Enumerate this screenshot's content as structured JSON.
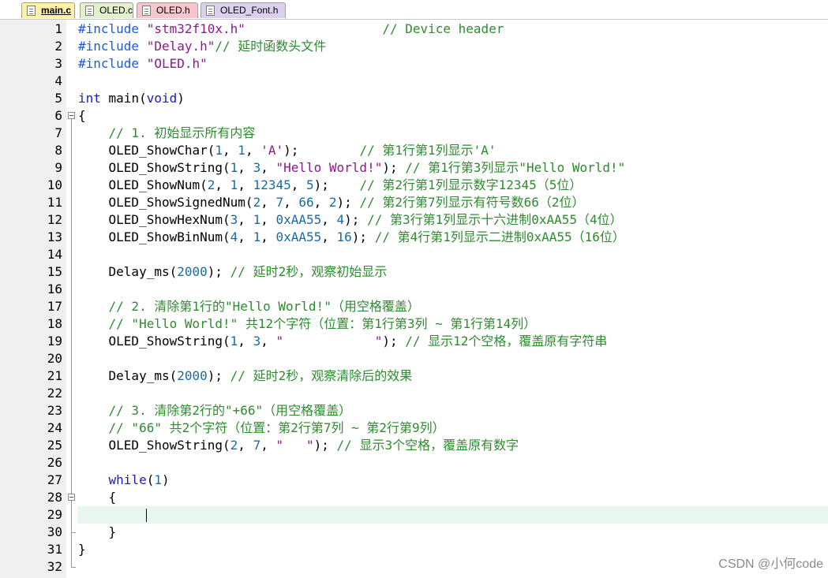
{
  "tabs": [
    {
      "label": "main.c",
      "active": true,
      "color": "#fff2a8"
    },
    {
      "label": "OLED.c",
      "active": false,
      "color": "#e2f0cc"
    },
    {
      "label": "OLED.h",
      "active": false,
      "color": "#f7c5cc"
    },
    {
      "label": "OLED_Font.h",
      "active": false,
      "color": "#dcd0ef"
    }
  ],
  "editor": {
    "current_line": 29,
    "lines": [
      [
        [
          "pp",
          "#include "
        ],
        [
          "str",
          "\"stm32f10x.h\""
        ],
        [
          "txt",
          "                  "
        ],
        [
          "cmt",
          "// Device header"
        ]
      ],
      [
        [
          "pp",
          "#include "
        ],
        [
          "str",
          "\"Delay.h\""
        ],
        [
          "cmt",
          "// 延时函数头文件"
        ]
      ],
      [
        [
          "pp",
          "#include "
        ],
        [
          "str",
          "\"OLED.h\""
        ]
      ],
      [],
      [
        [
          "kw",
          "int"
        ],
        [
          "txt",
          " main("
        ],
        [
          "kw",
          "void"
        ],
        [
          "txt",
          ")"
        ]
      ],
      [
        [
          "txt",
          "{"
        ]
      ],
      [
        [
          "txt",
          "    "
        ],
        [
          "cmt",
          "// 1. 初始显示所有内容"
        ]
      ],
      [
        [
          "txt",
          "    OLED_ShowChar("
        ],
        [
          "num",
          "1"
        ],
        [
          "txt",
          ", "
        ],
        [
          "num",
          "1"
        ],
        [
          "txt",
          ", "
        ],
        [
          "str",
          "'A'"
        ],
        [
          "txt",
          ");        "
        ],
        [
          "cmt",
          "// 第1行第1列显示'A'"
        ]
      ],
      [
        [
          "txt",
          "    OLED_ShowString("
        ],
        [
          "num",
          "1"
        ],
        [
          "txt",
          ", "
        ],
        [
          "num",
          "3"
        ],
        [
          "txt",
          ", "
        ],
        [
          "str",
          "\"Hello World!\""
        ],
        [
          "txt",
          "); "
        ],
        [
          "cmt",
          "// 第1行第3列显示\"Hello World!\""
        ]
      ],
      [
        [
          "txt",
          "    OLED_ShowNum("
        ],
        [
          "num",
          "2"
        ],
        [
          "txt",
          ", "
        ],
        [
          "num",
          "1"
        ],
        [
          "txt",
          ", "
        ],
        [
          "num",
          "12345"
        ],
        [
          "txt",
          ", "
        ],
        [
          "num",
          "5"
        ],
        [
          "txt",
          ");    "
        ],
        [
          "cmt",
          "// 第2行第1列显示数字12345（5位）"
        ]
      ],
      [
        [
          "txt",
          "    OLED_ShowSignedNum("
        ],
        [
          "num",
          "2"
        ],
        [
          "txt",
          ", "
        ],
        [
          "num",
          "7"
        ],
        [
          "txt",
          ", "
        ],
        [
          "num",
          "66"
        ],
        [
          "txt",
          ", "
        ],
        [
          "num",
          "2"
        ],
        [
          "txt",
          "); "
        ],
        [
          "cmt",
          "// 第2行第7列显示有符号数66（2位）"
        ]
      ],
      [
        [
          "txt",
          "    OLED_ShowHexNum("
        ],
        [
          "num",
          "3"
        ],
        [
          "txt",
          ", "
        ],
        [
          "num",
          "1"
        ],
        [
          "txt",
          ", "
        ],
        [
          "num",
          "0xAA55"
        ],
        [
          "txt",
          ", "
        ],
        [
          "num",
          "4"
        ],
        [
          "txt",
          "); "
        ],
        [
          "cmt",
          "// 第3行第1列显示十六进制0xAA55（4位）"
        ]
      ],
      [
        [
          "txt",
          "    OLED_ShowBinNum("
        ],
        [
          "num",
          "4"
        ],
        [
          "txt",
          ", "
        ],
        [
          "num",
          "1"
        ],
        [
          "txt",
          ", "
        ],
        [
          "num",
          "0xAA55"
        ],
        [
          "txt",
          ", "
        ],
        [
          "num",
          "16"
        ],
        [
          "txt",
          "); "
        ],
        [
          "cmt",
          "// 第4行第1列显示二进制0xAA55（16位）"
        ]
      ],
      [],
      [
        [
          "txt",
          "    Delay_ms("
        ],
        [
          "num",
          "2000"
        ],
        [
          "txt",
          "); "
        ],
        [
          "cmt",
          "// 延时2秒，观察初始显示"
        ]
      ],
      [],
      [
        [
          "txt",
          "    "
        ],
        [
          "cmt",
          "// 2. 清除第1行的\"Hello World!\"（用空格覆盖）"
        ]
      ],
      [
        [
          "txt",
          "    "
        ],
        [
          "cmt",
          "// \"Hello World!\" 共12个字符（位置：第1行第3列 ~ 第1行第14列）"
        ]
      ],
      [
        [
          "txt",
          "    OLED_ShowString("
        ],
        [
          "num",
          "1"
        ],
        [
          "txt",
          ", "
        ],
        [
          "num",
          "3"
        ],
        [
          "txt",
          ", "
        ],
        [
          "str",
          "\"            \""
        ],
        [
          "txt",
          "); "
        ],
        [
          "cmt",
          "// 显示12个空格，覆盖原有字符串"
        ]
      ],
      [],
      [
        [
          "txt",
          "    Delay_ms("
        ],
        [
          "num",
          "2000"
        ],
        [
          "txt",
          "); "
        ],
        [
          "cmt",
          "// 延时2秒，观察清除后的效果"
        ]
      ],
      [],
      [
        [
          "txt",
          "    "
        ],
        [
          "cmt",
          "// 3. 清除第2行的\"+66\"（用空格覆盖）"
        ]
      ],
      [
        [
          "txt",
          "    "
        ],
        [
          "cmt",
          "// \"66\" 共2个字符（位置：第2行第7列 ~ 第2行第9列）"
        ]
      ],
      [
        [
          "txt",
          "    OLED_ShowString("
        ],
        [
          "num",
          "2"
        ],
        [
          "txt",
          ", "
        ],
        [
          "num",
          "7"
        ],
        [
          "txt",
          ", "
        ],
        [
          "str",
          "\"   \""
        ],
        [
          "txt",
          "); "
        ],
        [
          "cmt",
          "// 显示3个空格，覆盖原有数字"
        ]
      ],
      [],
      [
        [
          "txt",
          "    "
        ],
        [
          "kw",
          "while"
        ],
        [
          "txt",
          "("
        ],
        [
          "num",
          "1"
        ],
        [
          "txt",
          ")"
        ]
      ],
      [
        [
          "txt",
          "    {"
        ]
      ],
      [],
      [
        [
          "txt",
          "    }"
        ]
      ],
      [
        [
          "txt",
          "}"
        ]
      ],
      []
    ]
  },
  "watermark": "CSDN @小何code"
}
